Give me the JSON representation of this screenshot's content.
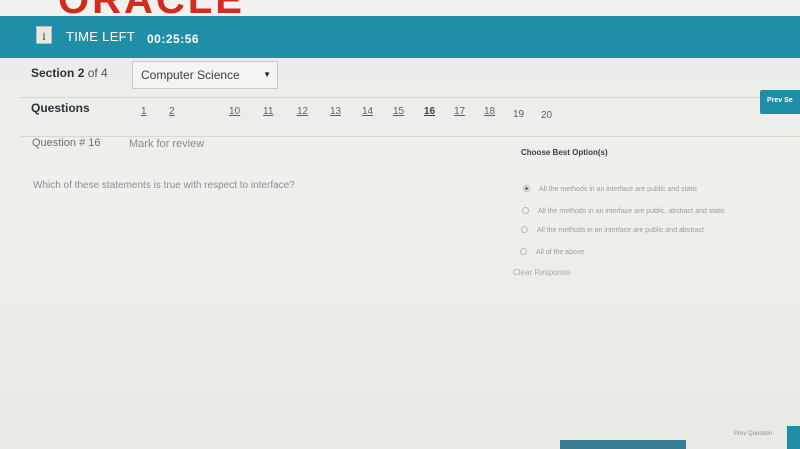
{
  "brand": {
    "logo_text": "ORACLE"
  },
  "timer": {
    "label": "TIME LEFT",
    "value": "00:25:56",
    "info_icon": "i"
  },
  "section": {
    "label": "Section",
    "current": "2",
    "of_text": "of 4",
    "subject": "Computer Science",
    "prev_section_button": "Prev Se"
  },
  "questions": {
    "label": "Questions",
    "numbers": [
      "1",
      "2",
      "10",
      "11",
      "12",
      "13",
      "14",
      "15",
      "16",
      "17",
      "18",
      "19",
      "20"
    ],
    "current": "16"
  },
  "question": {
    "number_text": "Question # 16",
    "mark_for_review": "Mark for review",
    "text": "Which of these statements is true with respect to interface?"
  },
  "options": {
    "title": "Choose Best Option(s)",
    "items": [
      "All the methods in an interface are public and static",
      "All the methods in an interface are public, abstract and static",
      "All the methods in an interface are public and abstract",
      "All of the above"
    ],
    "selected_index": 0,
    "clear_response": "Clear Response"
  },
  "footer": {
    "prev_question": "Prev Question"
  },
  "colors": {
    "accent": "#1f8fa8",
    "logo": "#d52b1e"
  }
}
